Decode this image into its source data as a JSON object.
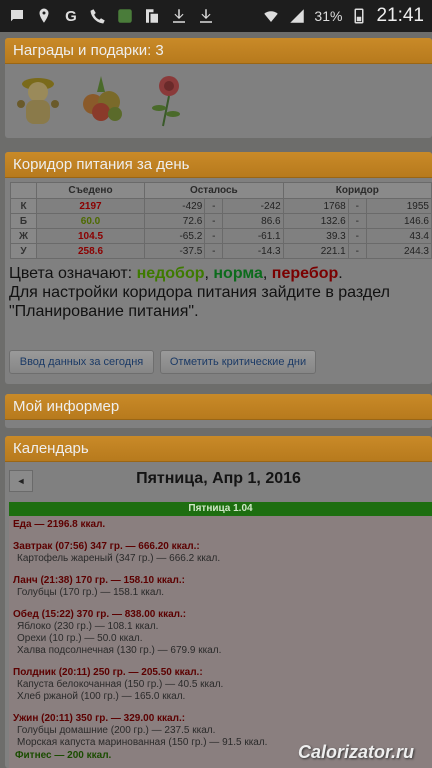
{
  "statusbar": {
    "battery": "31%",
    "time": "21:41"
  },
  "awards": {
    "title": "Награды и подарки: 3"
  },
  "corridor": {
    "title": "Коридор питания за день",
    "headers": {
      "eaten": "Съедено",
      "left": "Осталось",
      "range": "Коридор"
    },
    "rows": [
      {
        "label": "К",
        "eaten": "2197",
        "left_from": "-429",
        "left_to": "-242",
        "min": "1768",
        "max": "1955",
        "eaten_color": "#8b0000"
      },
      {
        "label": "Б",
        "eaten": "60.0",
        "left_from": "72.6",
        "left_to": "86.6",
        "min": "132.6",
        "max": "146.6",
        "eaten_color": "#4d6a00"
      },
      {
        "label": "Ж",
        "eaten": "104.5",
        "left_from": "-65.2",
        "left_to": "-61.1",
        "min": "39.3",
        "max": "43.4",
        "eaten_color": "#8b0000"
      },
      {
        "label": "У",
        "eaten": "258.6",
        "left_from": "-37.5",
        "left_to": "-14.3",
        "min": "221.1",
        "max": "244.3",
        "eaten_color": "#8b0000"
      }
    ],
    "dash": "-",
    "legend_prefix": "Цвета означают: ",
    "legend_under": "недобор",
    "legend_sep1": ", ",
    "legend_norm": "норма",
    "legend_sep2": ", ",
    "legend_over": "перебор",
    "legend_end": ".",
    "legend_note": "Для настройки коридора питания зайдите в раздел \"Планирование питания\".",
    "button_input": "Ввод данных за сегодня",
    "button_critical": "Отметить критические дни"
  },
  "informer": {
    "title": "Мой информер"
  },
  "calendar": {
    "title": "Календарь",
    "prev": "◄",
    "date": "Пятница, Апр 1, 2016",
    "day_bar": "Пятница 1.04",
    "food_total": "Еда — 2196.8 ккал.",
    "meals": [
      {
        "title": "Завтрак (07:56) 347 гр. — 666.20 ккал.:",
        "items": [
          "Картофель жареный (347 гр.) — 666.2 ккал."
        ]
      },
      {
        "title": "Ланч (21:38) 170 гр. — 158.10 ккал.:",
        "items": [
          "Голубцы (170 гр.) — 158.1 ккал."
        ]
      },
      {
        "title": "Обед (15:22) 370 гр. — 838.00 ккал.:",
        "items": [
          "Яблоко (230 гр.) — 108.1 ккал.",
          "Орехи (10 гр.) — 50.0 ккал.",
          "Халва подсолнечная (130 гр.) — 679.9 ккал."
        ]
      },
      {
        "title": "Полдник (20:11) 250 гр. — 205.50 ккал.:",
        "items": [
          "Капуста белокочанная (150 гр.) — 40.5 ккал.",
          "Хлеб ржаной (100 гр.) — 165.0 ккал."
        ]
      },
      {
        "title": "Ужин (20:11) 350 гр. — 329.00 ккал.:",
        "items": [
          "Голубцы домашние (200 гр.) — 237.5 ккал.",
          "Морская капуста маринованная (150 гр.) — 91.5 ккал."
        ]
      }
    ],
    "fitness": "Фитнес — 200 ккал."
  },
  "watermark": "Calorizator.ru"
}
